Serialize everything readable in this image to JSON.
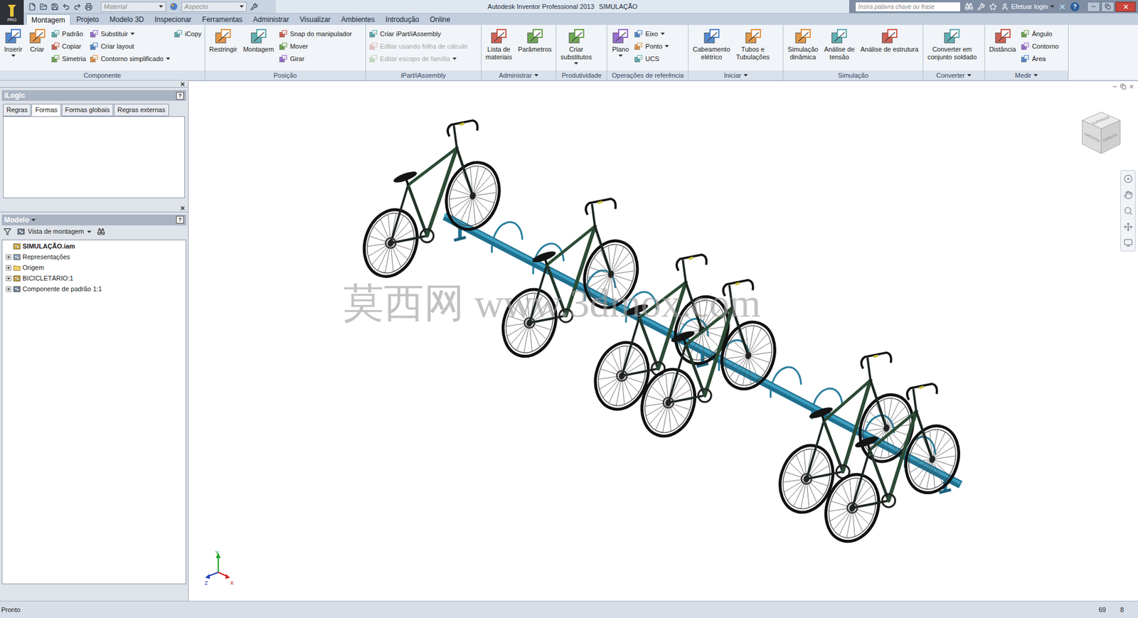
{
  "window": {
    "title": "Autodesk Inventor Professional 2013",
    "document": "SIMULAÇÃO",
    "app_badge": "PRO"
  },
  "quick_access": {
    "material": "Material",
    "appearance": "Aspecto"
  },
  "search": {
    "placeholder": "Insira palavra chave ou frase"
  },
  "account": {
    "label": "Efetuar login",
    "help": "?"
  },
  "ribbon_tabs": [
    {
      "label": "Montagem",
      "selected": true
    },
    {
      "label": "Projeto",
      "selected": false
    },
    {
      "label": "Modelo 3D",
      "selected": false
    },
    {
      "label": "Inspecionar",
      "selected": false
    },
    {
      "label": "Ferramentas",
      "selected": false
    },
    {
      "label": "Administrar",
      "selected": false
    },
    {
      "label": "Visualizar",
      "selected": false
    },
    {
      "label": "Ambientes",
      "selected": false
    },
    {
      "label": "Introdução",
      "selected": false
    },
    {
      "label": "Online",
      "selected": false
    }
  ],
  "ribbon_groups": [
    {
      "label": "Componente",
      "menu": false,
      "items": [
        {
          "kind": "large",
          "lines": [
            "Inserir"
          ],
          "disabled": false,
          "menu": true
        },
        {
          "kind": "large",
          "lines": [
            "Criar"
          ],
          "disabled": false,
          "menu": false
        },
        {
          "kind": "small",
          "label": "Padrão",
          "disabled": false,
          "menu": false
        },
        {
          "kind": "small",
          "label": "Copiar",
          "disabled": false,
          "menu": false
        },
        {
          "kind": "small",
          "label": "Simetria",
          "disabled": false,
          "menu": false
        },
        {
          "kind": "small",
          "label": "Substituir",
          "disabled": false,
          "menu": true
        },
        {
          "kind": "small",
          "label": "Criar layout",
          "disabled": false,
          "menu": false
        },
        {
          "kind": "small",
          "label": "Contorno simplificado",
          "disabled": false,
          "menu": true
        },
        {
          "kind": "small",
          "label": "iCopy",
          "disabled": false,
          "menu": false
        }
      ]
    },
    {
      "label": "Posição",
      "menu": false,
      "items": [
        {
          "kind": "large",
          "lines": [
            "Restringir"
          ],
          "disabled": false,
          "menu": false
        },
        {
          "kind": "large",
          "lines": [
            "Montagem"
          ],
          "disabled": false,
          "menu": false
        },
        {
          "kind": "small",
          "label": "Snap do manipulador",
          "disabled": false,
          "menu": false
        },
        {
          "kind": "small",
          "label": "Mover",
          "disabled": false,
          "menu": false
        },
        {
          "kind": "small",
          "label": "Girar",
          "disabled": false,
          "menu": false
        }
      ]
    },
    {
      "label": "iPart/iAssembly",
      "menu": false,
      "items": [
        {
          "kind": "small",
          "label": "Criar iPart/iAssembly",
          "disabled": false,
          "menu": false
        },
        {
          "kind": "small",
          "label": "Editar usando folha de cálculo",
          "disabled": true,
          "menu": false
        },
        {
          "kind": "small",
          "label": "Editar escopo de família",
          "disabled": true,
          "menu": true
        }
      ]
    },
    {
      "label": "Administrar",
      "menu": true,
      "items": [
        {
          "kind": "large",
          "lines": [
            "Lista de",
            "materiais"
          ],
          "disabled": false,
          "menu": false
        },
        {
          "kind": "large",
          "lines": [
            "Parâmetros"
          ],
          "disabled": false,
          "menu": false
        }
      ]
    },
    {
      "label": "Produtividade",
      "menu": false,
      "items": [
        {
          "kind": "large",
          "lines": [
            "Criar",
            "substitutos"
          ],
          "disabled": false,
          "menu": true
        }
      ]
    },
    {
      "label": "Operações de referência",
      "menu": false,
      "items": [
        {
          "kind": "large",
          "lines": [
            "Plano"
          ],
          "disabled": false,
          "menu": true
        },
        {
          "kind": "small",
          "label": "Eixo",
          "disabled": false,
          "menu": true
        },
        {
          "kind": "small",
          "label": "Ponto",
          "disabled": false,
          "menu": true
        },
        {
          "kind": "small",
          "label": "UCS",
          "disabled": false,
          "menu": false
        }
      ]
    },
    {
      "label": "Iniciar",
      "menu": true,
      "items": [
        {
          "kind": "large",
          "lines": [
            "Cabeamento",
            "elétrico"
          ],
          "disabled": false,
          "menu": false
        },
        {
          "kind": "large",
          "lines": [
            "Tubos e",
            "Tubulações"
          ],
          "disabled": false,
          "menu": false
        }
      ]
    },
    {
      "label": "Simulação",
      "menu": false,
      "items": [
        {
          "kind": "large",
          "lines": [
            "Simulação",
            "dinâmica"
          ],
          "disabled": false,
          "menu": false
        },
        {
          "kind": "large",
          "lines": [
            "Análise de",
            "tensão"
          ],
          "disabled": false,
          "menu": false
        },
        {
          "kind": "large",
          "lines": [
            "Análise de estrutura"
          ],
          "disabled": false,
          "menu": false
        }
      ]
    },
    {
      "label": "Converter",
      "menu": true,
      "items": [
        {
          "kind": "large",
          "lines": [
            "Converter em",
            "conjunto soldado"
          ],
          "disabled": false,
          "menu": false
        }
      ]
    },
    {
      "label": "Medir",
      "menu": true,
      "items": [
        {
          "kind": "large",
          "lines": [
            "Distância"
          ],
          "disabled": false,
          "menu": false
        },
        {
          "kind": "small",
          "label": "Ângulo",
          "disabled": false,
          "menu": false
        },
        {
          "kind": "small",
          "label": "Contorno",
          "disabled": false,
          "menu": false
        },
        {
          "kind": "small",
          "label": "Área",
          "disabled": false,
          "menu": false
        }
      ]
    }
  ],
  "ilogic": {
    "title": "iLogic",
    "help": "?",
    "tabs": [
      {
        "label": "Regras",
        "selected": false
      },
      {
        "label": "Formas",
        "selected": true
      },
      {
        "label": "Formas globais",
        "selected": false
      },
      {
        "label": "Regras externas",
        "selected": false
      }
    ]
  },
  "model": {
    "title": "Modelo",
    "menu": true,
    "help": "?",
    "view": "Vista de montagem",
    "tree": [
      {
        "label": "SIMULAÇÃO.iam",
        "level": 0,
        "expandable": false,
        "expanded": false,
        "bold": true
      },
      {
        "label": "Representações",
        "level": 0,
        "expandable": true,
        "expanded": false,
        "bold": false
      },
      {
        "label": "Origem",
        "level": 0,
        "expandable": true,
        "expanded": false,
        "bold": false
      },
      {
        "label": "BICICLETÁRIO:1",
        "level": 0,
        "expandable": true,
        "expanded": false,
        "bold": false
      },
      {
        "label": "Componente de padrão 1:1",
        "level": 0,
        "expandable": true,
        "expanded": false,
        "bold": false
      }
    ]
  },
  "viewport": {
    "watermark": "莫西网 www.3dmox.com",
    "viewcube": [
      "SUPERIOR",
      "FRONTAL",
      "DIREITA"
    ],
    "axes": [
      {
        "label": "Y",
        "color": "#22a022"
      },
      {
        "label": "Z",
        "color": "#1f3fbf"
      },
      {
        "label": "X",
        "color": "#d02020"
      }
    ]
  },
  "status_bar": {
    "text": "Pronto",
    "values": [
      "69",
      "8"
    ]
  }
}
